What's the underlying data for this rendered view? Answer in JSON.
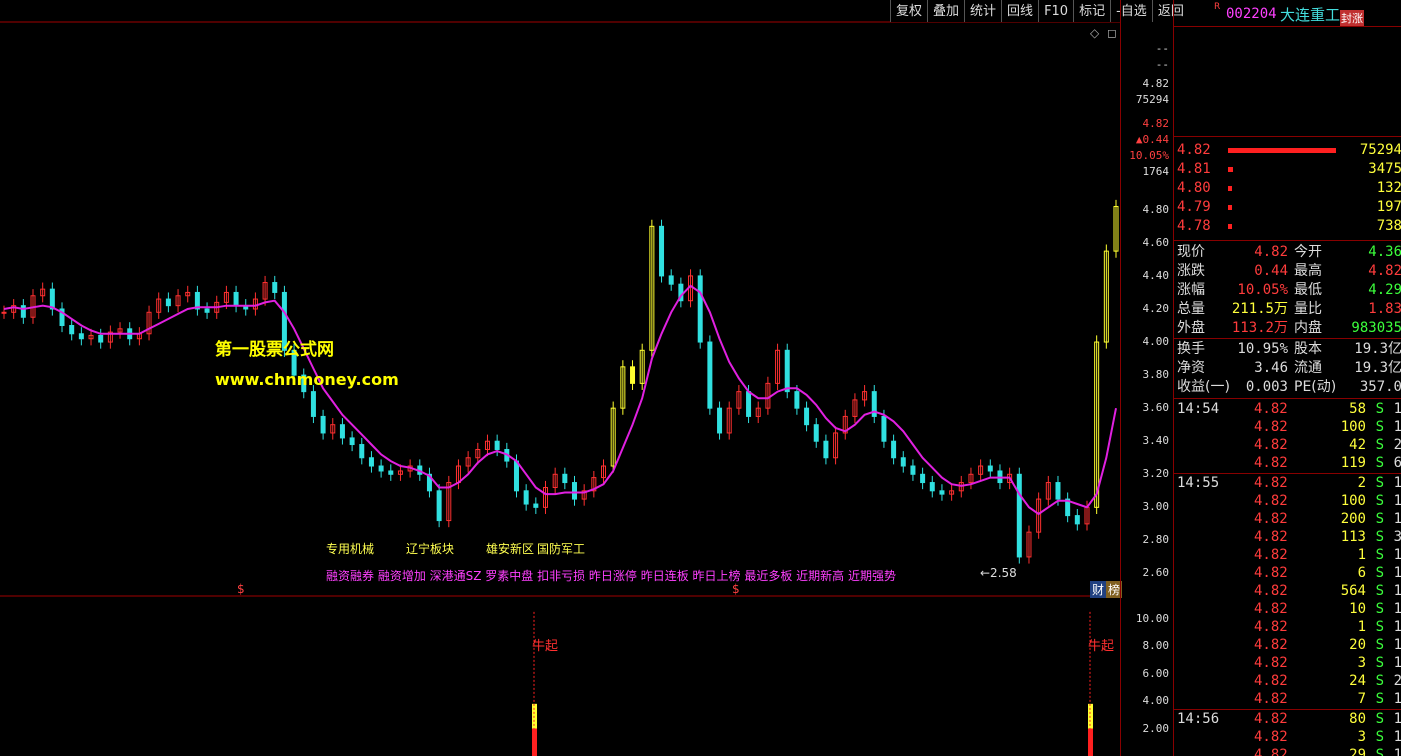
{
  "toolbar": {
    "buttons": [
      "复权",
      "叠加",
      "统计",
      "回线",
      "F10",
      "标记",
      "-自选",
      "返回"
    ]
  },
  "stock": {
    "r_badge": "R",
    "code": "002204",
    "name": "大连重工",
    "status_tag": "封涨"
  },
  "watermark": {
    "line1": "第一股票公式网",
    "line2": "www.chnmoney.com"
  },
  "annotations": {
    "concepts": [
      "专用机械",
      "辽宁板块",
      "雄安新区",
      "国防军工"
    ],
    "flags": "融资融券 融资增加 深港通SZ 罗素中盘 扣非亏损 昨日涨停 昨日连板 昨日上榜 最近多板 近期新高 近期强势",
    "low_label": "←2.58",
    "dollar_mark": "$",
    "buy_signal": "牛起",
    "corner_diamond": "◇",
    "corner_box": "◻",
    "tag_cai": "财",
    "tag_bang": "榜"
  },
  "axis": {
    "top_info": [
      "--",
      "--",
      "4.82",
      "75294",
      "4.82",
      "▲0.44",
      "10.05%",
      "1764"
    ],
    "price_ticks": [
      "4.80",
      "4.60",
      "4.40",
      "4.20",
      "4.00",
      "3.80",
      "3.60",
      "3.40",
      "3.20",
      "3.00",
      "2.80",
      "2.60"
    ],
    "indicator_ticks": [
      "10.00",
      "8.00",
      "6.00",
      "4.00",
      "2.00"
    ]
  },
  "quotes": [
    {
      "price": "4.82",
      "vol": "75294",
      "bar": 1.0
    },
    {
      "price": "4.81",
      "vol": "3475",
      "bar": 0.05
    },
    {
      "price": "4.80",
      "vol": "132",
      "bar": 0.02
    },
    {
      "price": "4.79",
      "vol": "197",
      "bar": 0.02
    },
    {
      "price": "4.78",
      "vol": "738",
      "bar": 0.02
    }
  ],
  "stats": [
    {
      "l1": "现价",
      "v1": "4.82",
      "c1": "r",
      "l2": "今开",
      "v2": "4.36",
      "c2": "g"
    },
    {
      "l1": "涨跌",
      "v1": "0.44",
      "c1": "r",
      "l2": "最高",
      "v2": "4.82",
      "c2": "r"
    },
    {
      "l1": "涨幅",
      "v1": "10.05%",
      "c1": "r",
      "l2": "最低",
      "v2": "4.29",
      "c2": "g"
    },
    {
      "l1": "总量",
      "v1": "211.5万",
      "c1": "y",
      "l2": "量比",
      "v2": "1.83",
      "c2": "r"
    },
    {
      "l1": "外盘",
      "v1": "113.2万",
      "c1": "r",
      "l2": "内盘",
      "v2": "983035",
      "c2": "g"
    }
  ],
  "stats2": [
    {
      "l1": "换手",
      "v1": "10.95%",
      "l2": "股本",
      "v2": "19.3亿"
    },
    {
      "l1": "净资",
      "v1": "3.46",
      "l2": "流通",
      "v2": "19.3亿"
    },
    {
      "l1": "收益(一)",
      "v1": "0.003",
      "l2": "PE(动)",
      "v2": "357.0"
    }
  ],
  "ticks": [
    {
      "time": "14:54",
      "price": "4.82",
      "vol": "58",
      "flag": "S",
      "n": "1"
    },
    {
      "time": "",
      "price": "4.82",
      "vol": "100",
      "flag": "S",
      "n": "1"
    },
    {
      "time": "",
      "price": "4.82",
      "vol": "42",
      "flag": "S",
      "n": "2"
    },
    {
      "time": "",
      "price": "4.82",
      "vol": "119",
      "flag": "S",
      "n": "6"
    },
    {
      "time": "14:55",
      "price": "4.82",
      "vol": "2",
      "flag": "S",
      "n": "1"
    },
    {
      "time": "",
      "price": "4.82",
      "vol": "100",
      "flag": "S",
      "n": "1"
    },
    {
      "time": "",
      "price": "4.82",
      "vol": "200",
      "flag": "S",
      "n": "1"
    },
    {
      "time": "",
      "price": "4.82",
      "vol": "113",
      "flag": "S",
      "n": "3"
    },
    {
      "time": "",
      "price": "4.82",
      "vol": "1",
      "flag": "S",
      "n": "1"
    },
    {
      "time": "",
      "price": "4.82",
      "vol": "6",
      "flag": "S",
      "n": "1"
    },
    {
      "time": "",
      "price": "4.82",
      "vol": "564",
      "flag": "S",
      "n": "1"
    },
    {
      "time": "",
      "price": "4.82",
      "vol": "10",
      "flag": "S",
      "n": "1"
    },
    {
      "time": "",
      "price": "4.82",
      "vol": "1",
      "flag": "S",
      "n": "1"
    },
    {
      "time": "",
      "price": "4.82",
      "vol": "20",
      "flag": "S",
      "n": "1"
    },
    {
      "time": "",
      "price": "4.82",
      "vol": "3",
      "flag": "S",
      "n": "1"
    },
    {
      "time": "",
      "price": "4.82",
      "vol": "24",
      "flag": "S",
      "n": "2"
    },
    {
      "time": "",
      "price": "4.82",
      "vol": "7",
      "flag": "S",
      "n": "1"
    },
    {
      "time": "14:56",
      "price": "4.82",
      "vol": "80",
      "flag": "S",
      "n": "1"
    },
    {
      "time": "",
      "price": "4.82",
      "vol": "3",
      "flag": "S",
      "n": "1"
    },
    {
      "time": "",
      "price": "4.82",
      "vol": "29",
      "flag": "S",
      "n": "1"
    }
  ],
  "chart_data": {
    "type": "line",
    "ylim": [
      2.5,
      4.95
    ],
    "closes": [
      4.18,
      4.22,
      4.15,
      4.28,
      4.32,
      4.2,
      4.1,
      4.05,
      4.02,
      4.04,
      4.0,
      4.06,
      4.08,
      4.02,
      4.05,
      4.18,
      4.26,
      4.22,
      4.28,
      4.3,
      4.2,
      4.18,
      4.24,
      4.3,
      4.22,
      4.2,
      4.26,
      4.36,
      4.3,
      3.95,
      3.8,
      3.7,
      3.55,
      3.45,
      3.5,
      3.42,
      3.38,
      3.3,
      3.25,
      3.22,
      3.2,
      3.22,
      3.25,
      3.2,
      3.1,
      2.92,
      3.15,
      3.25,
      3.3,
      3.35,
      3.4,
      3.35,
      3.28,
      3.1,
      3.02,
      3.0,
      3.12,
      3.2,
      3.15,
      3.05,
      3.1,
      3.18,
      3.25,
      3.6,
      3.85,
      3.75,
      3.95,
      4.7,
      4.4,
      4.35,
      4.25,
      4.4,
      4.0,
      3.6,
      3.45,
      3.6,
      3.7,
      3.55,
      3.6,
      3.75,
      3.95,
      3.7,
      3.6,
      3.5,
      3.4,
      3.3,
      3.45,
      3.55,
      3.65,
      3.7,
      3.55,
      3.4,
      3.3,
      3.25,
      3.2,
      3.15,
      3.1,
      3.08,
      3.1,
      3.15,
      3.2,
      3.25,
      3.22,
      3.15,
      3.2,
      2.7,
      2.85,
      3.05,
      3.15,
      3.05,
      2.95,
      2.9,
      3.0,
      4.0,
      4.55,
      4.82
    ],
    "ma": [
      4.2,
      4.21,
      4.2,
      4.21,
      4.22,
      4.21,
      4.18,
      4.14,
      4.1,
      4.07,
      4.05,
      4.05,
      4.05,
      4.05,
      4.05,
      4.08,
      4.11,
      4.14,
      4.17,
      4.2,
      4.21,
      4.21,
      4.21,
      4.22,
      4.22,
      4.22,
      4.22,
      4.24,
      4.25,
      4.18,
      4.08,
      3.96,
      3.84,
      3.72,
      3.64,
      3.56,
      3.5,
      3.44,
      3.38,
      3.32,
      3.28,
      3.25,
      3.24,
      3.22,
      3.19,
      3.12,
      3.12,
      3.15,
      3.2,
      3.27,
      3.32,
      3.34,
      3.32,
      3.28,
      3.2,
      3.12,
      3.08,
      3.08,
      3.09,
      3.09,
      3.09,
      3.11,
      3.14,
      3.22,
      3.36,
      3.5,
      3.66,
      3.9,
      4.05,
      4.18,
      4.28,
      4.34,
      4.3,
      4.18,
      4.02,
      3.88,
      3.78,
      3.7,
      3.66,
      3.66,
      3.7,
      3.72,
      3.72,
      3.68,
      3.62,
      3.54,
      3.48,
      3.46,
      3.5,
      3.56,
      3.58,
      3.56,
      3.52,
      3.46,
      3.38,
      3.3,
      3.24,
      3.18,
      3.14,
      3.13,
      3.14,
      3.16,
      3.18,
      3.18,
      3.18,
      3.08,
      3.0,
      2.96,
      3.0,
      3.04,
      3.04,
      3.02,
      3.0,
      3.08,
      3.3,
      3.6
    ]
  }
}
